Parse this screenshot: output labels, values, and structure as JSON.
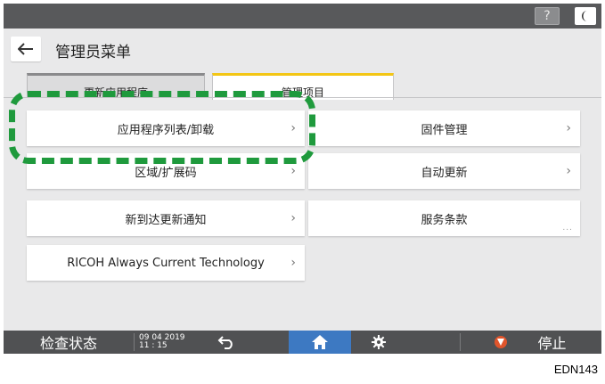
{
  "topbar": {
    "help_label": "?",
    "night_icon": "moon-icon"
  },
  "header": {
    "back_icon": "back-arrow-icon",
    "title": "管理员菜单"
  },
  "tabs": [
    {
      "label": "更新应用程序",
      "selected": false
    },
    {
      "label": "管理项目",
      "selected": true
    }
  ],
  "menu": {
    "left": [
      {
        "label": "应用程序列表/卸载"
      },
      {
        "label": "区域/扩展码"
      },
      {
        "label": "新到达更新通知"
      },
      {
        "label": "RICOH Always Current Technology"
      }
    ],
    "right": [
      {
        "label": "固件管理"
      },
      {
        "label": "自动更新"
      },
      {
        "label": "服务条款",
        "more": "..."
      }
    ],
    "chevron": "›"
  },
  "bottombar": {
    "check_status": "检查状态",
    "date": "09 04 2019",
    "time": "11 : 15",
    "stop_label": "停止"
  },
  "accent_colors": {
    "tab_highlight": "#f3c615",
    "home": "#3d79c2",
    "stop": "#e0552c",
    "callout": "#1f9a3d"
  },
  "caption": "EDN143"
}
